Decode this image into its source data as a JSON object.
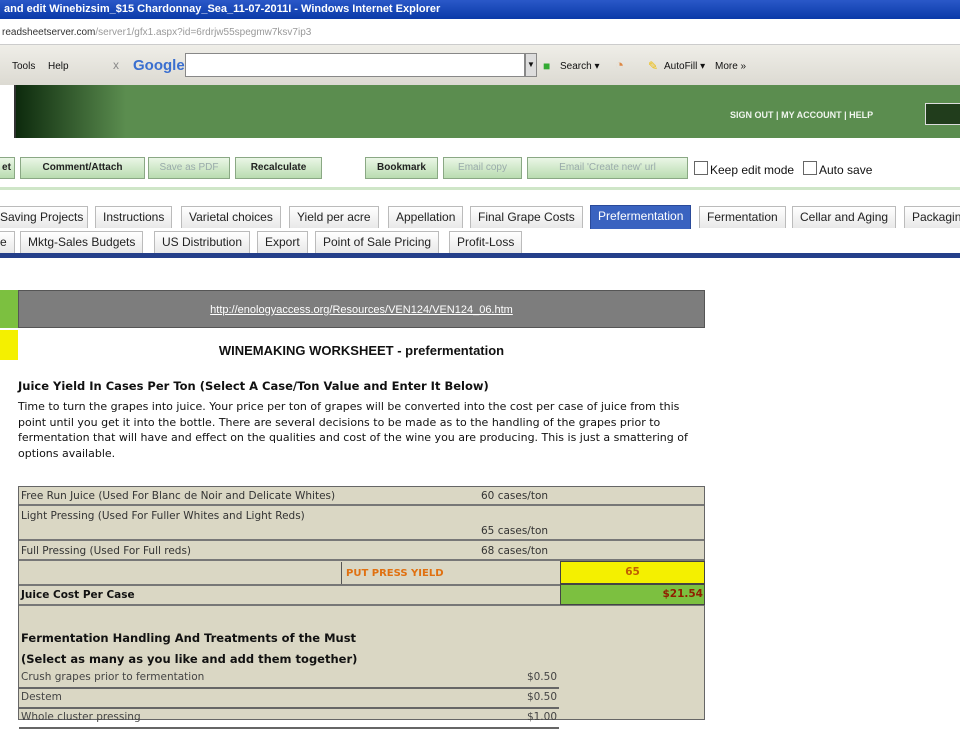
{
  "browser": {
    "title": "and edit Winebizsim_$15 Chardonnay_Sea_11-07-2011I - Windows Internet Explorer",
    "url_host": "readsheetserver.com",
    "url_path": "/server1/gfx1.aspx?id=6rdrjw55spegmw7ksv7ip3",
    "menu_tools": "Tools",
    "menu_help": "Help",
    "close": "x",
    "google": "Google",
    "search": "Search ▾",
    "autofill": "AutoFill ▾",
    "more": "More »"
  },
  "header": {
    "sign_out": "SIGN OUT",
    "my_account": "MY ACCOUNT",
    "help": "HELP",
    "sep": "|"
  },
  "buttons": {
    "reset": "et",
    "comment": "Comment/Attach",
    "pdf": "Save as PDF",
    "recalc": "Recalculate",
    "bookmark": "Bookmark",
    "email_copy": "Email copy",
    "email_url": "Email 'Create new' url",
    "keep_edit": "Keep edit mode",
    "auto_save": "Auto save"
  },
  "tabs_row1": [
    "Saving Projects",
    "Instructions",
    "Varietal choices",
    "Yield per acre",
    "Appellation",
    "Final Grape Costs",
    "Prefermentation",
    "Fermentation",
    "Cellar and Aging",
    "Packaging"
  ],
  "tabs_row2": [
    "e",
    "Mktg-Sales Budgets",
    "US Distribution",
    "Export",
    "Point of Sale Pricing",
    "Profit-Loss"
  ],
  "sheet": {
    "link": "http://enologyaccess.org/Resources/VEN124/VEN124_06.htm",
    "title": "WINEMAKING WORKSHEET - prefermentation",
    "heading": "Juice Yield In Cases Per Ton (Select A Case/Ton Value and Enter It Below)",
    "paragraph": "Time to turn the grapes into juice. Your price per ton of grapes will be converted into the cost per case of juice from this point until you get it into the bottle. There are several decisions to be made as to the handling of the grapes prior to fermentation that will have and effect on the qualities and cost of the wine you are producing. This is just a smattering of options available.",
    "yields": [
      {
        "label": "Free Run Juice (Used For Blanc de Noir and Delicate Whites)",
        "value": "60 cases/ton"
      },
      {
        "label": "Light Pressing (Used For Fuller Whites and Light Reds)",
        "value": "65 cases/ton"
      },
      {
        "label": "Full Pressing (Used For Full reds)",
        "value": "68 cases/ton"
      }
    ],
    "put_press_label": "PUT PRESS YIELD",
    "put_press_value": "65",
    "juice_cost_label": "Juice Cost Per Case",
    "juice_cost_value": "$21.54",
    "ferm_heading1": "Fermentation Handling And Treatments of the Must",
    "ferm_heading2": "(Select as many as you like and add them together)",
    "ferm_items": [
      {
        "label": "Crush grapes prior to fermentation",
        "value": "$0.50"
      },
      {
        "label": "Destem",
        "value": "$0.50"
      },
      {
        "label": "Whole cluster pressing",
        "value": "$1.00"
      }
    ]
  }
}
